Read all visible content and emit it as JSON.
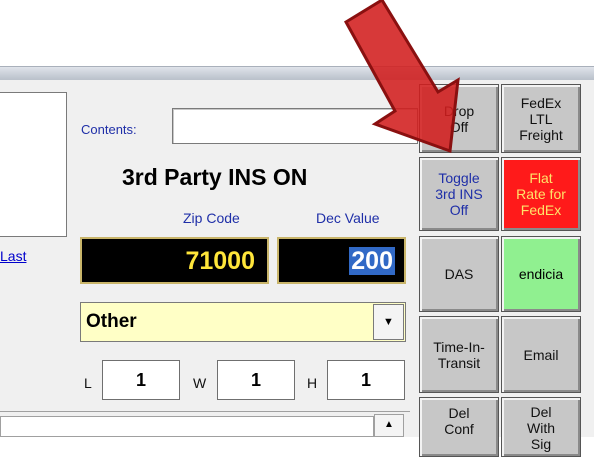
{
  "form": {
    "contents_label": "Contents:",
    "contents_value": "",
    "insurance_status": "3rd Party INS ON",
    "zip_label": "Zip Code",
    "zip_value": "71000",
    "dec_label": "Dec Value",
    "dec_value": "200",
    "package_type": "Other",
    "dimensions": {
      "l_label": "L",
      "l_value": "1",
      "w_label": "W",
      "w_value": "1",
      "h_label": "H",
      "h_value": "1"
    },
    "last_link": "Last"
  },
  "buttons": [
    {
      "label": "Drop\nOff"
    },
    {
      "label": "FedEx\nLTL\nFreight"
    },
    {
      "label": "Toggle\n3rd INS\nOff"
    },
    {
      "label": "Flat\nRate for\nFedEx",
      "color": "#ff1a1a"
    },
    {
      "label": "DAS"
    },
    {
      "label": "endicia",
      "color": "#90f090"
    },
    {
      "label": "Time-In-\nTransit"
    },
    {
      "label": "Email"
    },
    {
      "label": "Del\nConf"
    },
    {
      "label": "Del\nWith\nSig"
    }
  ],
  "arrow": {
    "color": "#d21e1e",
    "icon": "red-arrow-pointer"
  }
}
